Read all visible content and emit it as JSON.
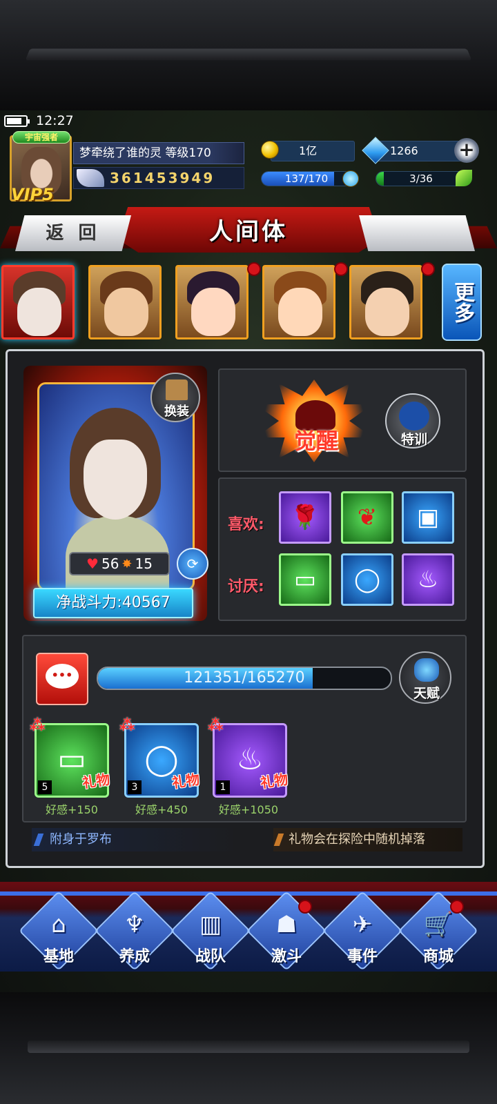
{
  "status_bar": {
    "time": "12:27",
    "battery_level": 0.8
  },
  "player": {
    "title_badge": "宇宙强者",
    "vip": "VIP5",
    "name_level": "梦牵绕了谁的灵 等级170",
    "id": "361453949"
  },
  "resources": {
    "gold": "1亿",
    "gems": "1266",
    "energy": {
      "text": "137/170",
      "value": 137,
      "max": 170
    },
    "stamina": {
      "text": "3/36",
      "value": 3,
      "max": 36
    }
  },
  "header": {
    "back_label": "返 回",
    "title": "人间体"
  },
  "roster": {
    "portraits": [
      {
        "name": "portrait-1",
        "selected": true,
        "badge": false
      },
      {
        "name": "portrait-2",
        "selected": false,
        "badge": false
      },
      {
        "name": "portrait-3",
        "selected": false,
        "badge": true
      },
      {
        "name": "portrait-4",
        "selected": false,
        "badge": true
      },
      {
        "name": "portrait-5",
        "selected": false,
        "badge": true
      }
    ],
    "more_label": "更多"
  },
  "character": {
    "swap_label": "换装",
    "hearts": "56",
    "awakening": "15",
    "power": "净战斗力:40567"
  },
  "actions": {
    "awaken_label": "觉醒",
    "train_label": "特训"
  },
  "preferences": {
    "likes_label": "喜欢:",
    "dislikes_label": "讨厌:",
    "likes": [
      "rose-icon",
      "scarf-icon",
      "gadget-icon"
    ],
    "dislikes": [
      "sign-icon",
      "ring-icon",
      "towel-icon"
    ]
  },
  "affection": {
    "xp_text": "121351/165270",
    "xp_value": 121351,
    "xp_max": 165270,
    "talent_label": "天赋"
  },
  "gifts": [
    {
      "count": "5",
      "tag": "礼物",
      "affinity": "好感+150",
      "icon": "sign-icon"
    },
    {
      "count": "3",
      "tag": "礼物",
      "affinity": "好感+450",
      "icon": "ring-icon"
    },
    {
      "count": "1",
      "tag": "礼物",
      "affinity": "好感+1050",
      "icon": "towel-icon"
    }
  ],
  "footer": {
    "possessed": "附身于罗布",
    "drop_hint": "礼物会在探险中随机掉落"
  },
  "nav": [
    {
      "label": "基地",
      "icon": "base-icon",
      "badge": false
    },
    {
      "label": "养成",
      "icon": "training-icon",
      "badge": false
    },
    {
      "label": "战队",
      "icon": "team-icon",
      "badge": false
    },
    {
      "label": "激斗",
      "icon": "battle-icon",
      "badge": true
    },
    {
      "label": "事件",
      "icon": "event-icon",
      "badge": false
    },
    {
      "label": "商城",
      "icon": "shop-icon",
      "badge": true
    }
  ],
  "colors": {
    "accent_red": "#c51a14",
    "accent_blue": "#1784c8",
    "like_label": "#ff5a6a",
    "affinity_green": "#9bd36b"
  }
}
